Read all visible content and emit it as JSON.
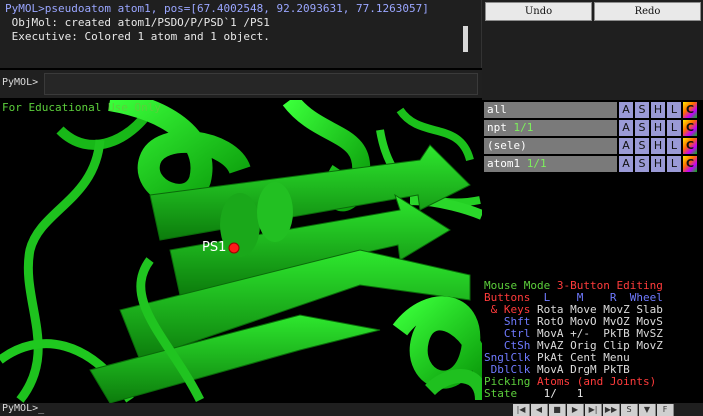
{
  "console": {
    "lines": [
      "PyMOL>pseudoatom atom1, pos=[67.4002548, 92.2093631, 77.1263057]",
      " ObjMol: created atom1/PSDO/P/PSD`1 /PS1",
      " Executive: Colored 1 atom and 1 object."
    ]
  },
  "toolbar": {
    "undo": "Undo",
    "redo": "Redo"
  },
  "command": {
    "prompt": "PyMOL>",
    "value": ""
  },
  "viewport": {
    "watermark": "For Educational Use Only",
    "atom_label": "PS1",
    "cartoon_color": "#22dd22"
  },
  "objects": [
    {
      "name": "all",
      "count": ""
    },
    {
      "name": "npt",
      "count": "1/1"
    },
    {
      "name": "(sele)",
      "count": ""
    },
    {
      "name": "atom1",
      "count": "1/1"
    }
  ],
  "object_buttons": [
    "A",
    "S",
    "H",
    "L",
    "C"
  ],
  "mouse": {
    "mode_label": "Mouse Mode",
    "mode_value": "3-Button Editing",
    "header": {
      "buttons": "Buttons",
      "l": "L",
      "m": "M",
      "r": "R",
      "wheel": "Wheel"
    },
    "rows": [
      {
        "key": " & Keys",
        "cols": [
          "Rota",
          "Move",
          "MovZ",
          "Slab"
        ]
      },
      {
        "key": "   Shft",
        "cols": [
          "RotO",
          "MovO",
          "MvOZ",
          "MovS"
        ]
      },
      {
        "key": "   Ctrl",
        "cols": [
          "MovA",
          "+/-",
          "PkTB",
          "MvSZ"
        ]
      },
      {
        "key": "   CtSh",
        "cols": [
          "MvAZ",
          "Orig",
          "Clip",
          "MovZ"
        ]
      },
      {
        "key": "SnglClk",
        "cols": [
          "PkAt",
          "Cent",
          "Menu",
          ""
        ]
      },
      {
        "key": " DblClk",
        "cols": [
          "MovA",
          "DrgM",
          "PkTB",
          ""
        ]
      }
    ],
    "picking": {
      "label": "Picking",
      "value": "Atoms (and Joints)"
    },
    "state": {
      "label": "State",
      "value": "1/",
      "total": "1"
    }
  },
  "bottom": {
    "prompt": "PyMOL>_",
    "nav": [
      "|◀",
      "◀",
      "■",
      "▶",
      "▶|",
      "▶▶",
      "S",
      "▼",
      "F"
    ]
  }
}
